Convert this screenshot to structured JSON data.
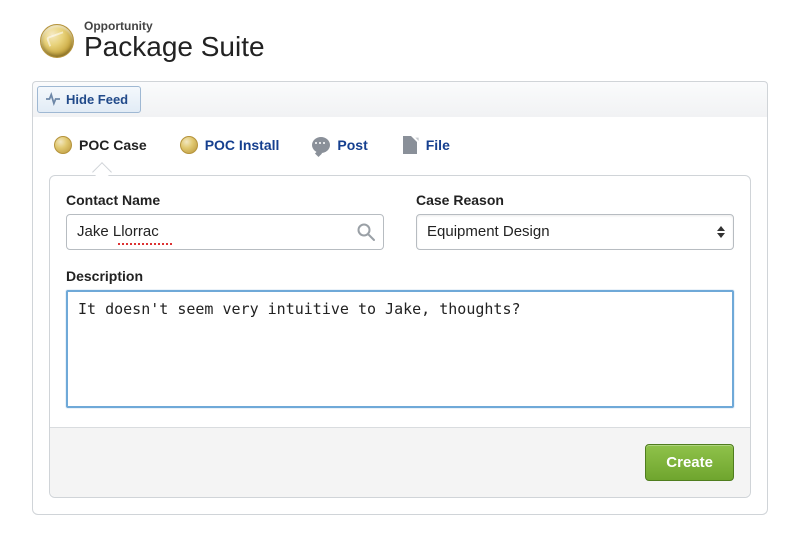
{
  "header": {
    "objectLabel": "Opportunity",
    "recordName": "Package Suite"
  },
  "feedToggle": {
    "label": "Hide Feed"
  },
  "tabs": [
    {
      "key": "poc_case",
      "label": "POC Case",
      "active": true
    },
    {
      "key": "poc_install",
      "label": "POC Install",
      "active": false
    },
    {
      "key": "post",
      "label": "Post",
      "active": false
    },
    {
      "key": "file",
      "label": "File",
      "active": false
    }
  ],
  "form": {
    "contactName": {
      "label": "Contact Name",
      "value": "Jake Llorrac"
    },
    "caseReason": {
      "label": "Case Reason",
      "value": "Equipment Design"
    },
    "description": {
      "label": "Description",
      "value": "It doesn't seem very intuitive to Jake, thoughts?"
    }
  },
  "actions": {
    "create": "Create"
  }
}
